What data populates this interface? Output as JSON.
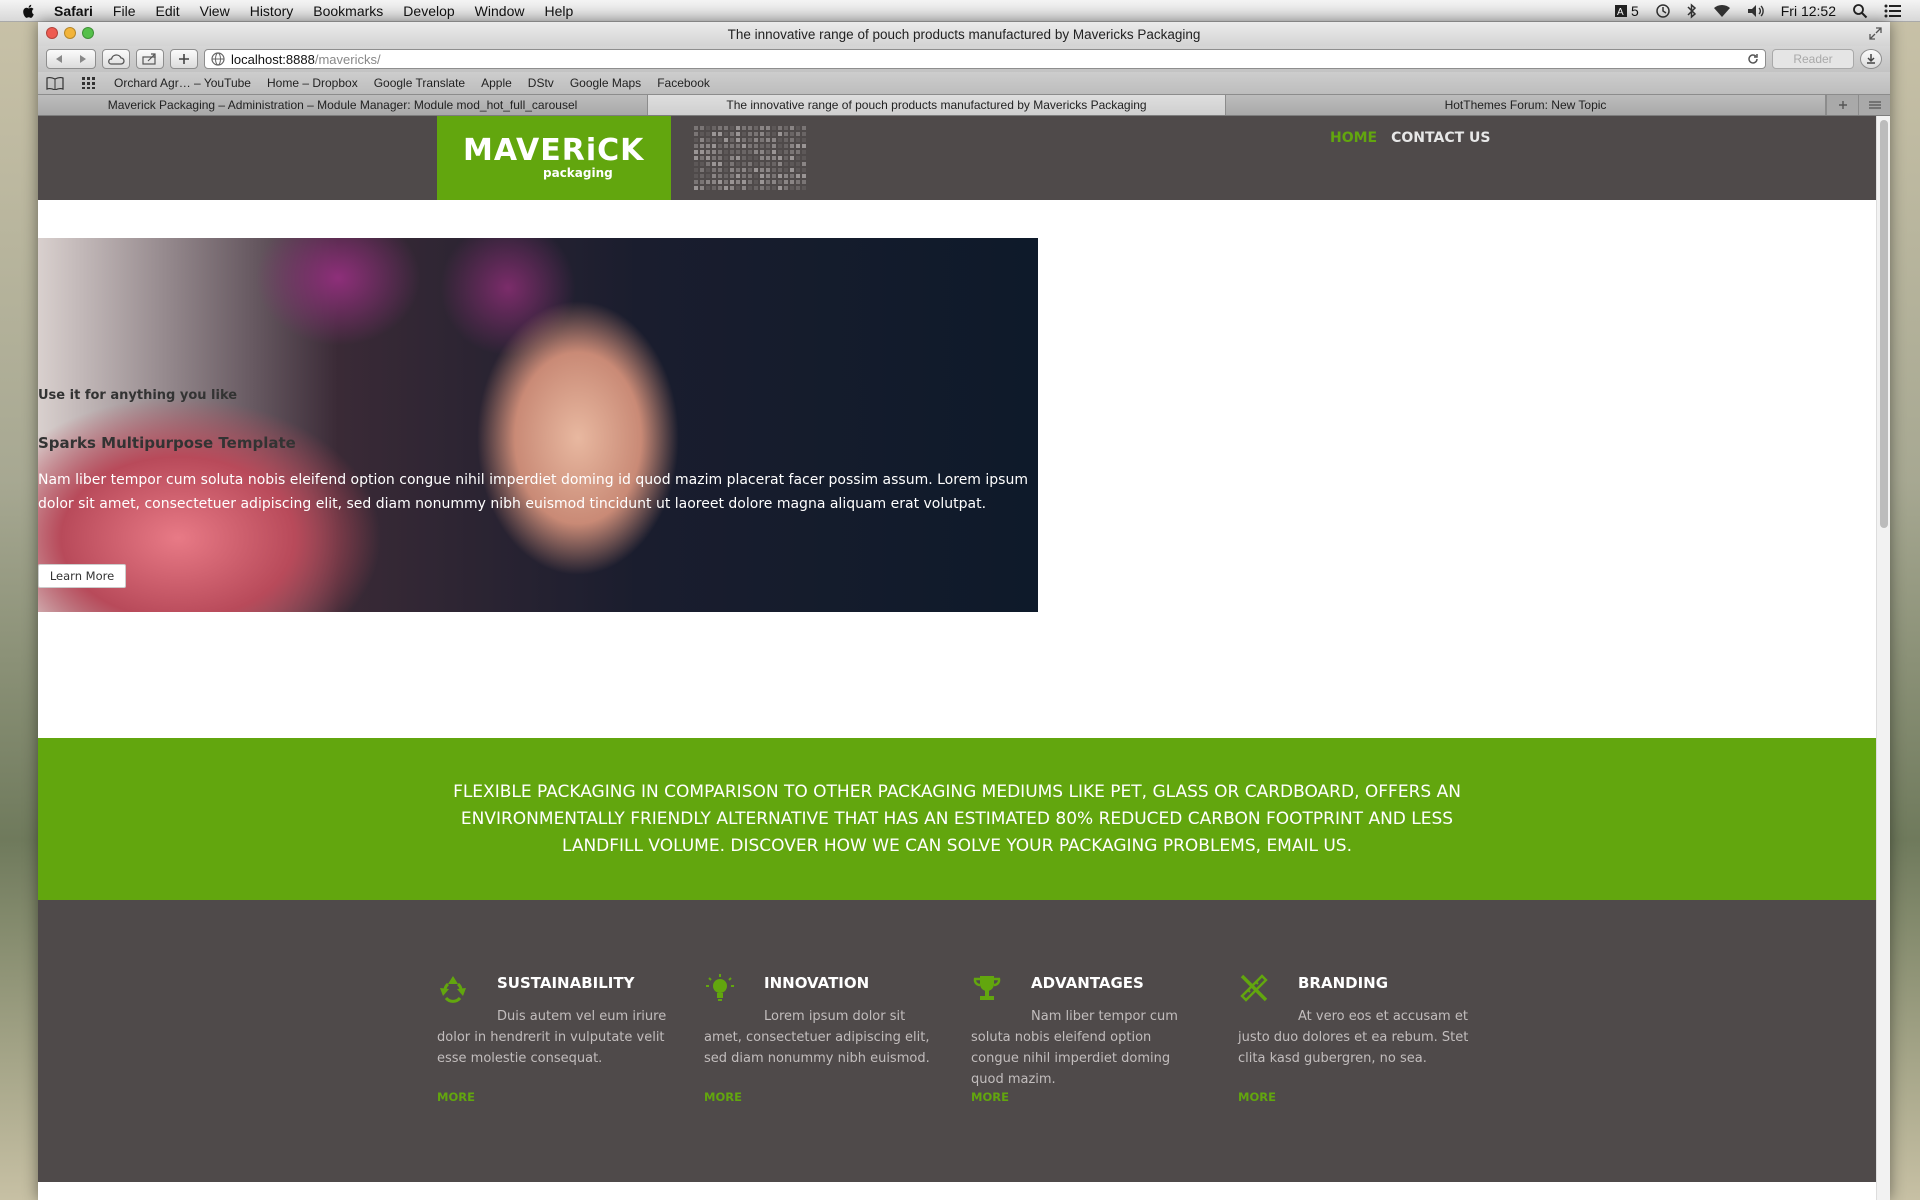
{
  "menubar": {
    "app": "Safari",
    "items": [
      "File",
      "Edit",
      "View",
      "History",
      "Bookmarks",
      "Develop",
      "Window",
      "Help"
    ],
    "status_badge": "5",
    "clock": "Fri 12:52"
  },
  "window": {
    "title": "The innovative range of pouch products manufactured by Mavericks Packaging"
  },
  "toolbar": {
    "url_host": "localhost:8888",
    "url_path": "/mavericks/",
    "reader_label": "Reader"
  },
  "bookmarks": [
    "Orchard Agr… – YouTube",
    "Home – Dropbox",
    "Google Translate",
    "Apple",
    "DStv",
    "Google Maps",
    "Facebook"
  ],
  "tabs": [
    {
      "label": "Maverick Packaging – Administration – Module Manager: Module mod_hot_full_carousel"
    },
    {
      "label": "The innovative range of pouch products manufactured by Mavericks Packaging"
    },
    {
      "label": "HotThemes Forum: New Topic"
    }
  ],
  "site": {
    "logo_main": "MAVERiCK",
    "logo_sub": "packaging",
    "nav": {
      "home": "HOME",
      "contact": "CONTACT US"
    },
    "hero": {
      "tagline": "Use it for anything you like",
      "title": "Sparks Multipurpose Template",
      "description": "Nam liber tempor cum soluta nobis eleifend option congue nihil imperdiet doming id quod mazim placerat facer possim assum. Lorem ipsum dolor sit amet, consectetuer adipiscing elit, sed diam nonummy nibh euismod tincidunt ut laoreet dolore magna aliquam erat volutpat.",
      "button": "Learn More"
    },
    "banner": "FLEXIBLE PACKAGING IN COMPARISON TO OTHER PACKAGING MEDIUMS LIKE PET, GLASS OR CARDBOARD, OFFERS AN ENVIRONMENTALLY FRIENDLY ALTERNATIVE THAT HAS AN ESTIMATED 80% REDUCED CARBON FOOTPRINT AND LESS LANDFILL VOLUME. DISCOVER HOW WE CAN SOLVE YOUR PACKAGING PROBLEMS, EMAIL US.",
    "features": [
      {
        "icon": "recycle-icon",
        "title": "SUSTAINABILITY",
        "text": "Duis autem vel eum iriure dolor in hendrerit in vulputate velit esse molestie consequat.",
        "more": "MORE"
      },
      {
        "icon": "lightbulb-icon",
        "title": "INNOVATION",
        "text": "Lorem ipsum dolor sit amet, consectetuer adipiscing elit, sed diam nonummy nibh euismod.",
        "more": "MORE"
      },
      {
        "icon": "trophy-icon",
        "title": "ADVANTAGES",
        "text": "Nam liber tempor cum soluta nobis eleifend option congue nihil imperdiet doming quod mazim.",
        "more": "MORE"
      },
      {
        "icon": "ruler-pencil-icon",
        "title": "BRANDING",
        "text": "At vero eos et accusam et justo duo dolores et ea rebum. Stet clita kasd gubergren, no sea.",
        "more": "MORE"
      }
    ]
  },
  "colors": {
    "brand_green": "#62a60e",
    "header_dark": "#4f4a4a"
  }
}
